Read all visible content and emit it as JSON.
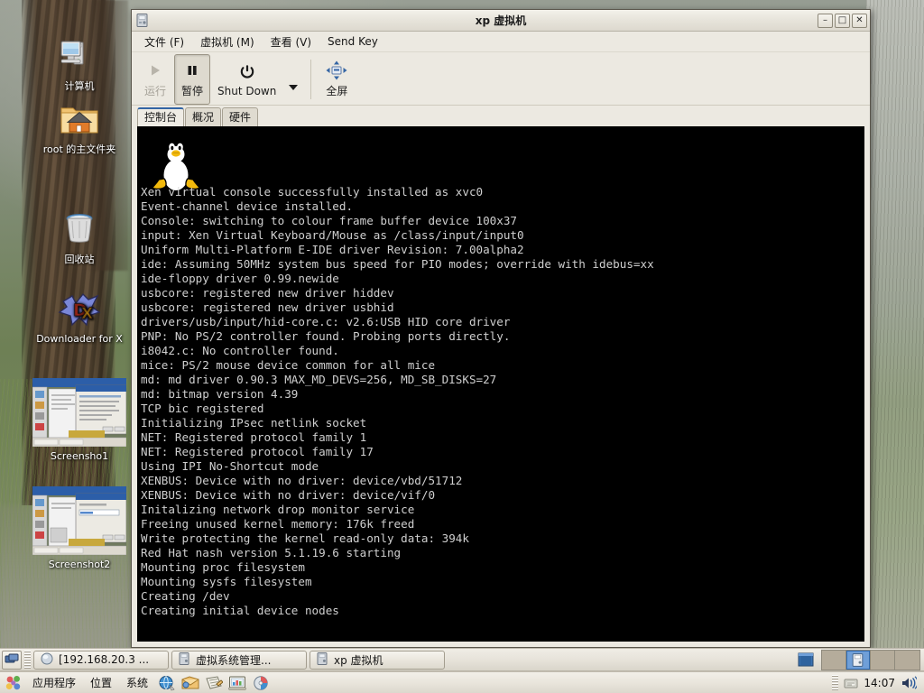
{
  "desktop": {
    "icons": [
      {
        "label": "计算机",
        "icon": "computer-icon"
      },
      {
        "label": "root 的主文件夹",
        "icon": "home-folder-icon"
      },
      {
        "label": "回收站",
        "icon": "trash-icon"
      },
      {
        "label": "Downloader for X",
        "icon": "downloader-icon"
      },
      {
        "label": "Screensho1",
        "icon": "screenshot-thumbnail-icon"
      },
      {
        "label": "Screenshot2",
        "icon": "screenshot-thumbnail-icon"
      }
    ]
  },
  "window": {
    "title": "xp 虚拟机",
    "icon": "vm-icon",
    "buttons": {
      "minimize": "–",
      "maximize": "□",
      "close": "✕"
    },
    "menus": [
      {
        "label": "文件 (F)"
      },
      {
        "label": "虚拟机 (M)"
      },
      {
        "label": "查看 (V)"
      },
      {
        "label": "Send Key"
      }
    ],
    "toolbar": {
      "run": {
        "label": "运行",
        "icon": "play-icon",
        "enabled": "false"
      },
      "pause": {
        "label": "暂停",
        "icon": "pause-icon",
        "pressed": "true"
      },
      "shutdown": {
        "label": "Shut Down",
        "icon": "power-icon"
      },
      "dropdown": {
        "icon": "chevron-down-icon"
      },
      "fullscreen": {
        "label": "全屏",
        "icon": "fullscreen-icon"
      }
    },
    "tabs": [
      {
        "label": "控制台",
        "active": "true"
      },
      {
        "label": "概况",
        "active": "false"
      },
      {
        "label": "硬件",
        "active": "false"
      }
    ],
    "console": {
      "logo": "tux-penguin-logo",
      "lines": [
        "Xen virtual console successfully installed as xvc0",
        "Event-channel device installed.",
        "Console: switching to colour frame buffer device 100x37",
        "input: Xen Virtual Keyboard/Mouse as /class/input/input0",
        "Uniform Multi-Platform E-IDE driver Revision: 7.00alpha2",
        "ide: Assuming 50MHz system bus speed for PIO modes; override with idebus=xx",
        "ide-floppy driver 0.99.newide",
        "usbcore: registered new driver hiddev",
        "usbcore: registered new driver usbhid",
        "drivers/usb/input/hid-core.c: v2.6:USB HID core driver",
        "PNP: No PS/2 controller found. Probing ports directly.",
        "i8042.c: No controller found.",
        "mice: PS/2 mouse device common for all mice",
        "md: md driver 0.90.3 MAX_MD_DEVS=256, MD_SB_DISKS=27",
        "md: bitmap version 4.39",
        "TCP bic registered",
        "Initializing IPsec netlink socket",
        "NET: Registered protocol family 1",
        "NET: Registered protocol family 17",
        "Using IPI No-Shortcut mode",
        "XENBUS: Device with no driver: device/vbd/51712",
        "XENBUS: Device with no driver: device/vif/0",
        "Initalizing network drop monitor service",
        "Freeing unused kernel memory: 176k freed",
        "Write protecting the kernel read-only data: 394k",
        "Red Hat nash version 5.1.19.6 starting",
        "Mounting proc filesystem",
        "Mounting sysfs filesystem",
        "Creating /dev",
        "Creating initial device nodes"
      ]
    }
  },
  "taskbar": {
    "show_desktop": {
      "icon": "show-desktop-icon"
    },
    "buttons": [
      {
        "label": "[192.168.20.3 ...",
        "icon": "terminal-icon",
        "active": "false"
      },
      {
        "label": "虚拟系统管理...",
        "icon": "vm-manager-icon",
        "active": "false"
      },
      {
        "label": "xp 虚拟机",
        "icon": "vm-icon",
        "active": "true"
      }
    ],
    "trash": {
      "icon": "trash-applet-icon"
    },
    "workspaces": [
      {
        "name": "workspace-1",
        "active": "false"
      },
      {
        "name": "workspace-2",
        "active": "true"
      },
      {
        "name": "workspace-3",
        "active": "false"
      },
      {
        "name": "workspace-4",
        "active": "false"
      }
    ]
  },
  "gnome_panel": {
    "logo": "gnome-foot-icon",
    "menus": [
      {
        "label": "应用程序"
      },
      {
        "label": "位置"
      },
      {
        "label": "系统"
      }
    ],
    "launchers": [
      {
        "name": "web-browser-icon"
      },
      {
        "name": "email-icon"
      },
      {
        "name": "text-editor-icon"
      },
      {
        "name": "presentation-icon"
      },
      {
        "name": "disk-icon"
      }
    ],
    "tray": {
      "grip": "panel-grip",
      "notification": "notification-icon",
      "clock": "14:07",
      "volume": "volume-icon"
    }
  },
  "colors": {
    "accent": "#3465a4",
    "window_bg": "#ece9e1",
    "console_bg": "#000000",
    "console_fg": "#cfcfcf",
    "workspace_active": "#6f9fd8"
  }
}
